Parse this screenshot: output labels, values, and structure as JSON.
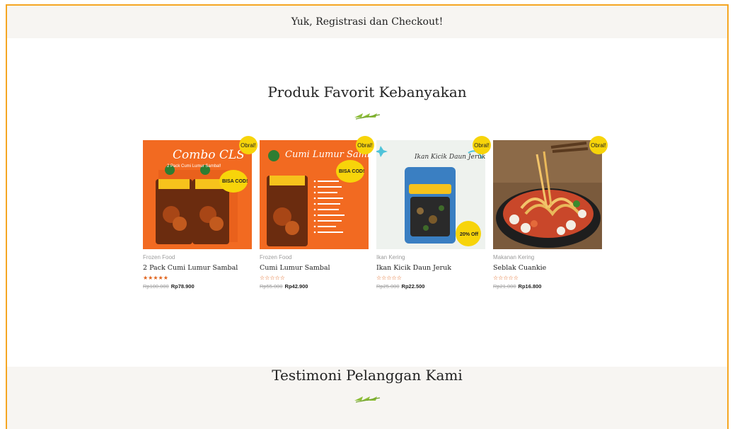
{
  "banner": {
    "text": "Yuk, Registrasi dan Checkout!"
  },
  "favorites": {
    "title": "Produk Favorit Kebanyakan",
    "products": [
      {
        "badge": "Obral!",
        "category": "Frozen Food",
        "name": "2 Pack Cumi Lumur Sambal",
        "rating": "★★★★★",
        "old_price": "Rp100.000",
        "new_price": "Rp78.900",
        "image": {
          "title": "Combo CLS",
          "subtitle": "2 Pack Cumi Lumur Sambal!",
          "sticker": "BISA COD!"
        }
      },
      {
        "badge": "Obral!",
        "category": "Frozen Food",
        "name": "Cumi Lumur Sambal",
        "rating": "☆☆☆☆☆",
        "old_price": "Rp55.000",
        "new_price": "Rp42.900",
        "image": {
          "title": "Cumi Lumur Sambal",
          "sticker": "BISA COD!"
        }
      },
      {
        "badge": "Obral!",
        "category": "Ikan Kering",
        "name": "Ikan Kicik Daun Jeruk",
        "rating": "☆☆☆☆☆",
        "old_price": "Rp25.000",
        "new_price": "Rp22.500",
        "image": {
          "title": "Ikan Kicik Daun Jeruk",
          "sticker": "20% Off"
        }
      },
      {
        "badge": "Obral!",
        "category": "Makanan Kering",
        "name": "Seblak Cuankie",
        "rating": "☆☆☆☆☆",
        "old_price": "Rp21.000",
        "new_price": "Rp16.800",
        "image": {}
      }
    ]
  },
  "testimonials": {
    "title": "Testimoni Pelanggan Kami"
  },
  "colors": {
    "frame_border": "#f5a623",
    "banner_bg": "#f7f5f2",
    "badge": "#f7d40a",
    "product_orange": "#f26a21",
    "rating": "#e0631c"
  }
}
